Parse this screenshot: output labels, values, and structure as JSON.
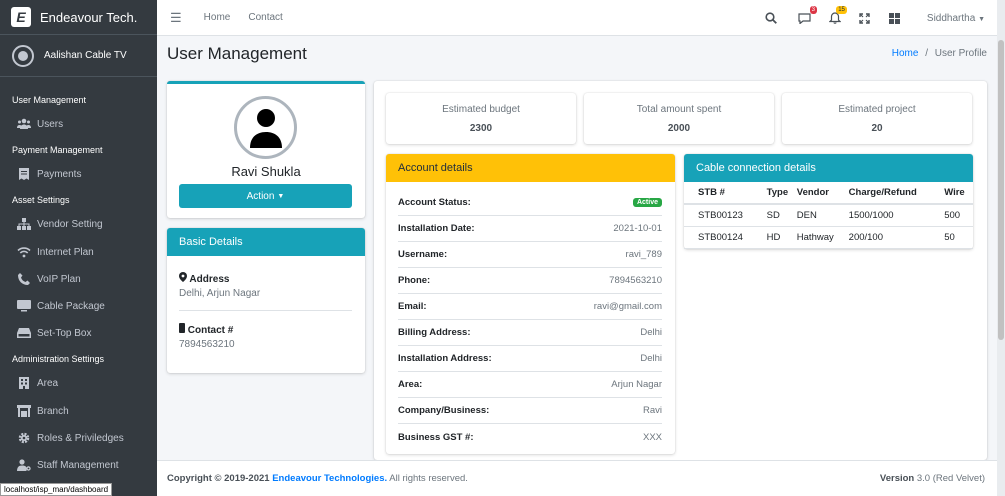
{
  "brand": {
    "name": "Endeavour Tech.",
    "logo_letter": "E"
  },
  "company": {
    "name": "Aalishan Cable TV"
  },
  "sidebar": {
    "headers": [
      "User Management",
      "Payment Management",
      "Asset Settings",
      "Administration Settings"
    ],
    "items": [
      {
        "label": "Users",
        "icon": "users-icon"
      },
      {
        "label": "Payments",
        "icon": "receipt-icon"
      },
      {
        "label": "Vendor Setting",
        "icon": "network-icon"
      },
      {
        "label": "Internet Plan",
        "icon": "wifi-icon"
      },
      {
        "label": "VoIP Plan",
        "icon": "phone-icon"
      },
      {
        "label": "Cable Package",
        "icon": "tv-icon"
      },
      {
        "label": "Set-Top Box",
        "icon": "hdd-icon"
      },
      {
        "label": "Area",
        "icon": "building-icon"
      },
      {
        "label": "Branch",
        "icon": "warehouse-icon"
      },
      {
        "label": "Roles & Priviledges",
        "icon": "gear-icon"
      },
      {
        "label": "Staff Management",
        "icon": "user-cog-icon"
      }
    ]
  },
  "status_url": "localhost/isp_man/dashboard",
  "topnav": {
    "links": [
      "Home",
      "Contact"
    ],
    "user": "Siddhartha",
    "msg_badge": "3",
    "notif_badge": "15"
  },
  "page": {
    "title": "User Management",
    "breadcrumb_home": "Home",
    "breadcrumb_current": "User Profile"
  },
  "profile": {
    "name": "Ravi Shukla",
    "action_label": "Action"
  },
  "basic_details": {
    "title": "Basic Details",
    "address_label": "Address",
    "address": "Delhi, Arjun Nagar",
    "contact_label": "Contact #",
    "contact": "7894563210"
  },
  "stats": [
    {
      "title": "Estimated budget",
      "value": "2300"
    },
    {
      "title": "Total amount spent",
      "value": "2000"
    },
    {
      "title": "Estimated project",
      "value": "20"
    }
  ],
  "account": {
    "title": "Account details",
    "rows": [
      {
        "label": "Account Status:",
        "value": "Active"
      },
      {
        "label": "Installation Date:",
        "value": "2021-10-01"
      },
      {
        "label": "Username:",
        "value": "ravi_789"
      },
      {
        "label": "Phone:",
        "value": "7894563210"
      },
      {
        "label": "Email:",
        "value": "ravi@gmail.com"
      },
      {
        "label": "Billing Address:",
        "value": "Delhi"
      },
      {
        "label": "Installation Address:",
        "value": "Delhi"
      },
      {
        "label": "Area:",
        "value": "Arjun Nagar"
      },
      {
        "label": "Company/Business:",
        "value": "Ravi"
      },
      {
        "label": "Business GST #:",
        "value": "XXX"
      }
    ]
  },
  "connection": {
    "title": "Cable connection details",
    "headers": [
      "STB #",
      "Type",
      "Vendor",
      "Charge/Refund",
      "Wire"
    ],
    "rows": [
      [
        "STB00123",
        "SD",
        "DEN",
        "1500/1000",
        "500"
      ],
      [
        "STB00124",
        "HD",
        "Hathway",
        "200/100",
        "50"
      ]
    ]
  },
  "footer": {
    "copyright": "Copyright © 2019-2021",
    "company": "Endeavour Technologies.",
    "rights": "All rights reserved.",
    "version_label": "Version",
    "version": "3.0 (Red Velvet)"
  }
}
